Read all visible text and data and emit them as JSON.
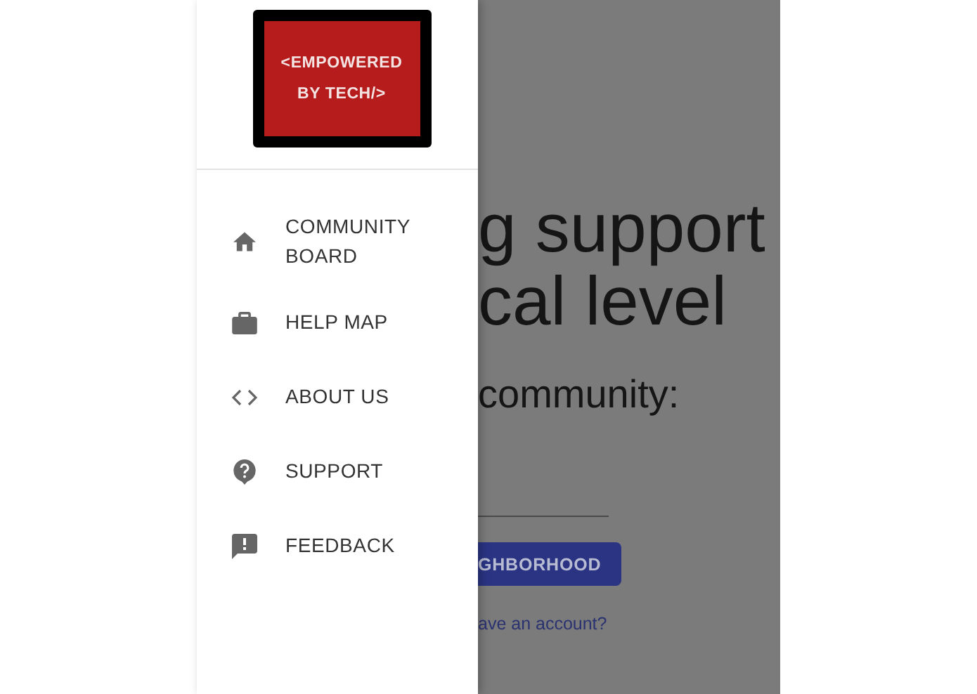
{
  "drawer": {
    "logo": {
      "lines": [
        "<EMPOWERED",
        "BY TECH/>"
      ]
    },
    "items": [
      {
        "label": "COMMUNITY BOARD"
      },
      {
        "label": "HELP MAP"
      },
      {
        "label": "ABOUT US"
      },
      {
        "label": "SUPPORT"
      },
      {
        "label": "FEEDBACK"
      }
    ]
  },
  "page": {
    "heading_lines": [
      "g support",
      "cal level"
    ],
    "subheading": "community:",
    "button": "GHBORHOOD",
    "link": "ave an account?"
  }
}
